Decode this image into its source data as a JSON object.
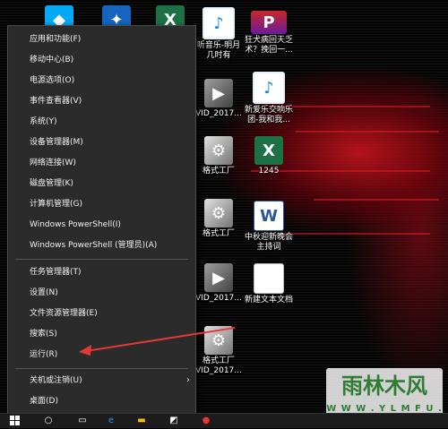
{
  "menu": {
    "items": [
      "应用和功能(F)",
      "移动中心(B)",
      "电源选项(O)",
      "事件查看器(V)",
      "系统(Y)",
      "设备管理器(M)",
      "网络连接(W)",
      "磁盘管理(K)",
      "计算机管理(G)",
      "Windows PowerShell(I)",
      "Windows PowerShell (管理员)(A)",
      "任务管理器(T)",
      "设置(N)",
      "文件资源管理器(E)",
      "搜索(S)",
      "运行(R)",
      "关机或注销(U)",
      "桌面(D)"
    ]
  },
  "desktop_icons": [
    {
      "label": "听音乐-明月\n几时有",
      "icon": "music-icon"
    },
    {
      "label": "狂犬病回天乏\n术？挽回一...",
      "icon": "presentation-icon"
    },
    {
      "label": "VID_2017...",
      "icon": "video-icon"
    },
    {
      "label": "新爱乐交响乐\n团-我和我...",
      "icon": "music-icon"
    },
    {
      "label": "格式工厂",
      "icon": "factory-icon"
    },
    {
      "label": "1245",
      "icon": "excel-icon"
    },
    {
      "label": "格式工厂",
      "icon": "factory-icon"
    },
    {
      "label": "中秋迎新晚会\n主持词",
      "icon": "word-icon"
    },
    {
      "label": "VID_2017...",
      "icon": "video-icon"
    },
    {
      "label": "新建文本文档",
      "icon": "text-document-icon"
    },
    {
      "label": "格式工厂\nVID_2017...",
      "icon": "factory-icon"
    }
  ],
  "watermark": {
    "logo_text": "雨林木风",
    "url": "W W W . Y L M F U . C O M"
  },
  "colors": {
    "menu_bg": "#2b2b2b",
    "arrow": "#e53935",
    "accent_red": "#d41e28"
  }
}
